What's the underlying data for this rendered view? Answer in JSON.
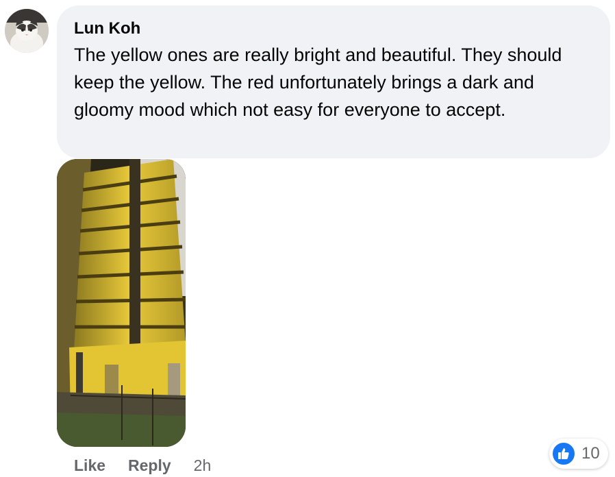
{
  "comment": {
    "author": "Lun Koh",
    "text": "The yellow ones are really bright and beautiful. They should keep the yellow. The red unfortunately brings a dark and gloomy mood which not easy for everyone to accept."
  },
  "attachment": {
    "icon": "building-photo"
  },
  "actions": {
    "like_label": "Like",
    "reply_label": "Reply",
    "timestamp": "2h"
  },
  "reactions": {
    "icon": "thumbs-up-icon",
    "count": "10",
    "color": "#1877f2"
  },
  "colors": {
    "bubble": "#f0f2f5",
    "secondary_text": "#65676b"
  }
}
